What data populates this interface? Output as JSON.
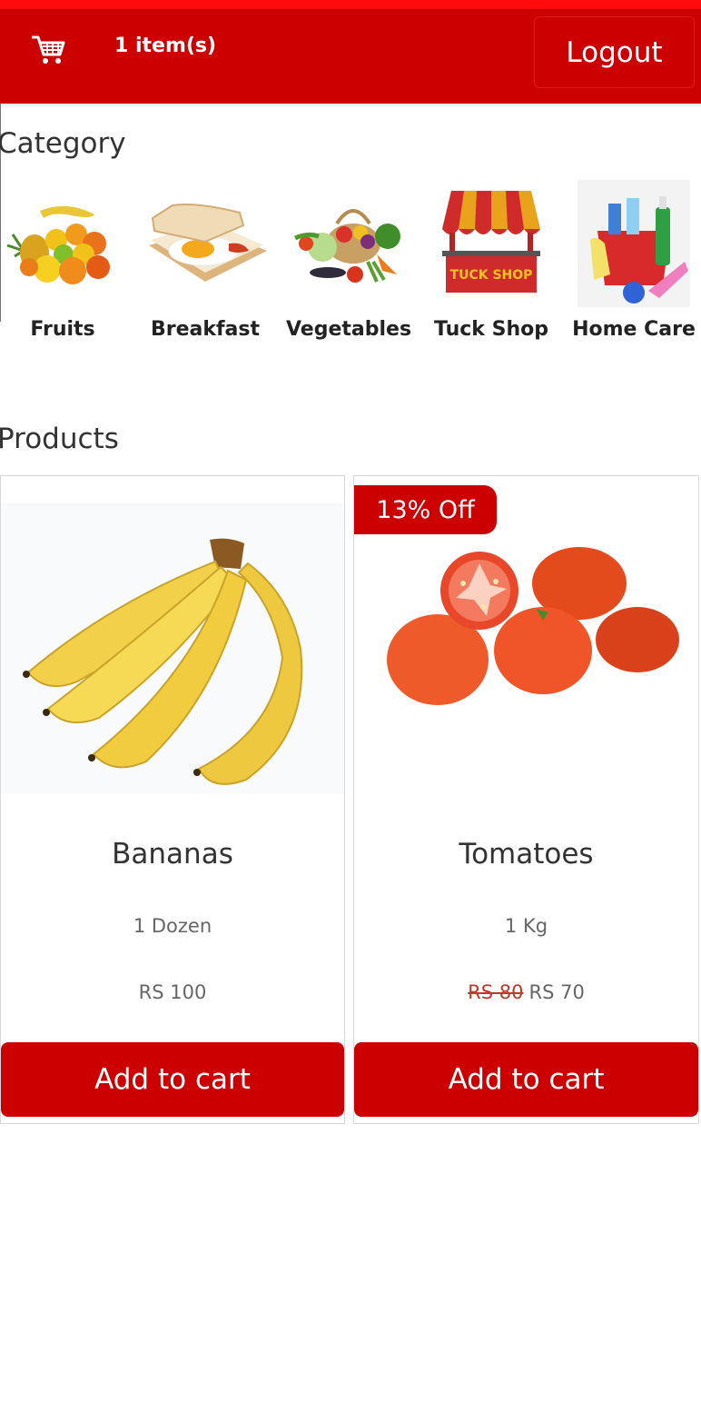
{
  "header": {
    "cart_count": "1  item(s)",
    "logout_label": "Logout",
    "accent_color": "#cc0000"
  },
  "categories": {
    "title": "Category",
    "items": [
      {
        "label": "Fruits",
        "icon": "fruits-icon"
      },
      {
        "label": "Breakfast",
        "icon": "breakfast-icon"
      },
      {
        "label": "Vegetables",
        "icon": "vegetables-icon"
      },
      {
        "label": "Tuck Shop",
        "icon": "tuck-shop-icon",
        "sign_text": "TUCK SHOP"
      },
      {
        "label": "Home Care",
        "icon": "home-care-icon"
      }
    ]
  },
  "products": {
    "title": "Products",
    "items": [
      {
        "name": "Bananas",
        "quantity": "1 Dozen",
        "price": "RS 100",
        "button": "Add to cart",
        "image": "bananas-image"
      },
      {
        "name": "Tomatoes",
        "quantity": "1 Kg",
        "old_price": "RS 80",
        "price": "RS 70",
        "badge": "13% Off",
        "button": "Add to cart",
        "image": "tomatoes-image"
      }
    ]
  }
}
